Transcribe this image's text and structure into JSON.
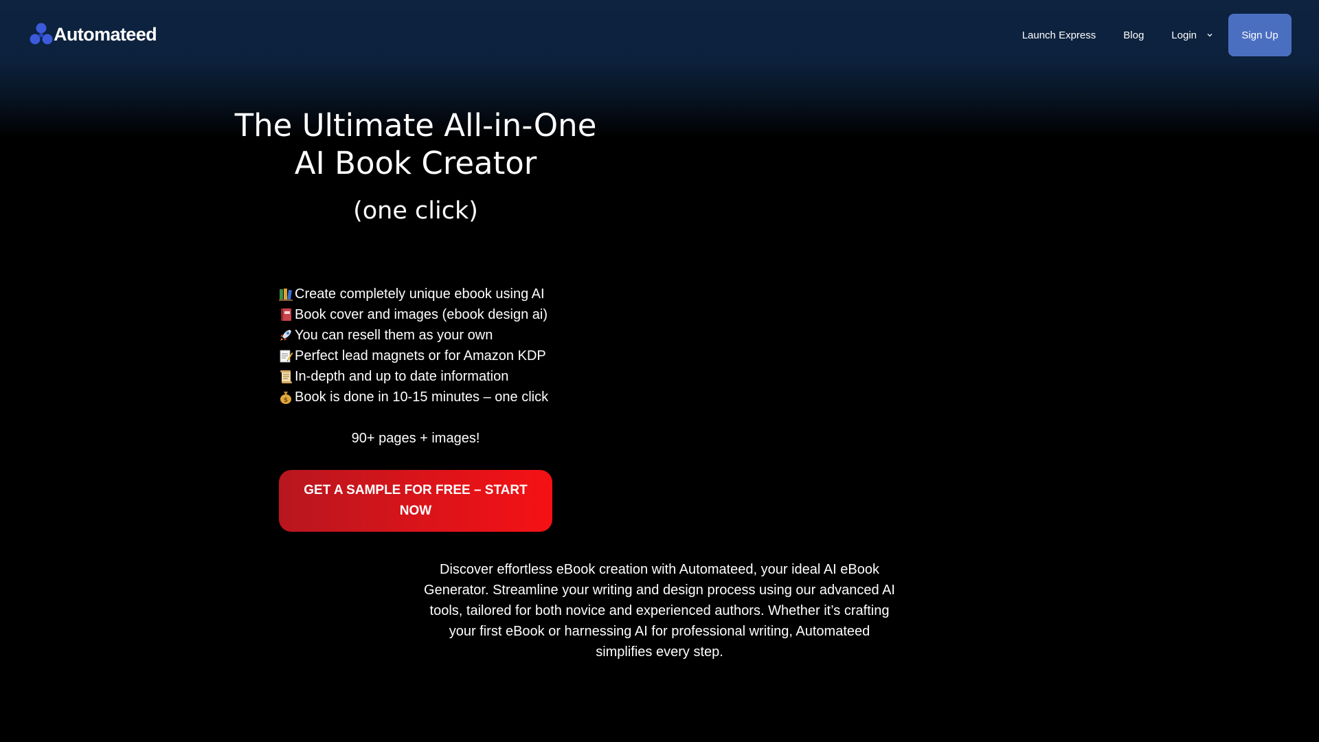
{
  "brand": {
    "name": "Automateed",
    "logo_color": "#3b5bdb"
  },
  "nav": {
    "launch_express": "Launch Express",
    "blog": "Blog",
    "login": "Login",
    "signup": "Sign Up",
    "signup_color": "#4a6fc1"
  },
  "hero": {
    "title_line1": "The Ultimate All-in-One",
    "title_line2": "AI Book Creator",
    "subtitle": "(one click)"
  },
  "features": [
    {
      "icon": "books-icon",
      "text": "Create completely unique ebook using AI"
    },
    {
      "icon": "notebook-icon",
      "text": "Book cover and images (ebook design ai)"
    },
    {
      "icon": "rocket-icon",
      "text": "You can resell them as your own"
    },
    {
      "icon": "memo-icon",
      "text": "Perfect lead magnets or for Amazon KDP"
    },
    {
      "icon": "scroll-icon",
      "text": "In-depth and up to date information"
    },
    {
      "icon": "money-bag-icon",
      "text": "Book is done in 10-15 minutes – one click"
    }
  ],
  "pages_note": "90+ pages + images!",
  "cta": {
    "label": "GET A SAMPLE FOR FREE – START NOW",
    "color": "#e31217"
  },
  "description": "Discover effortless eBook creation with Automateed, your ideal AI eBook Generator. Streamline your writing and design process using our advanced AI tools, tailored for both novice and experienced authors. Whether it’s crafting your first eBook or harnessing AI for professional writing, Automateed simplifies every step."
}
